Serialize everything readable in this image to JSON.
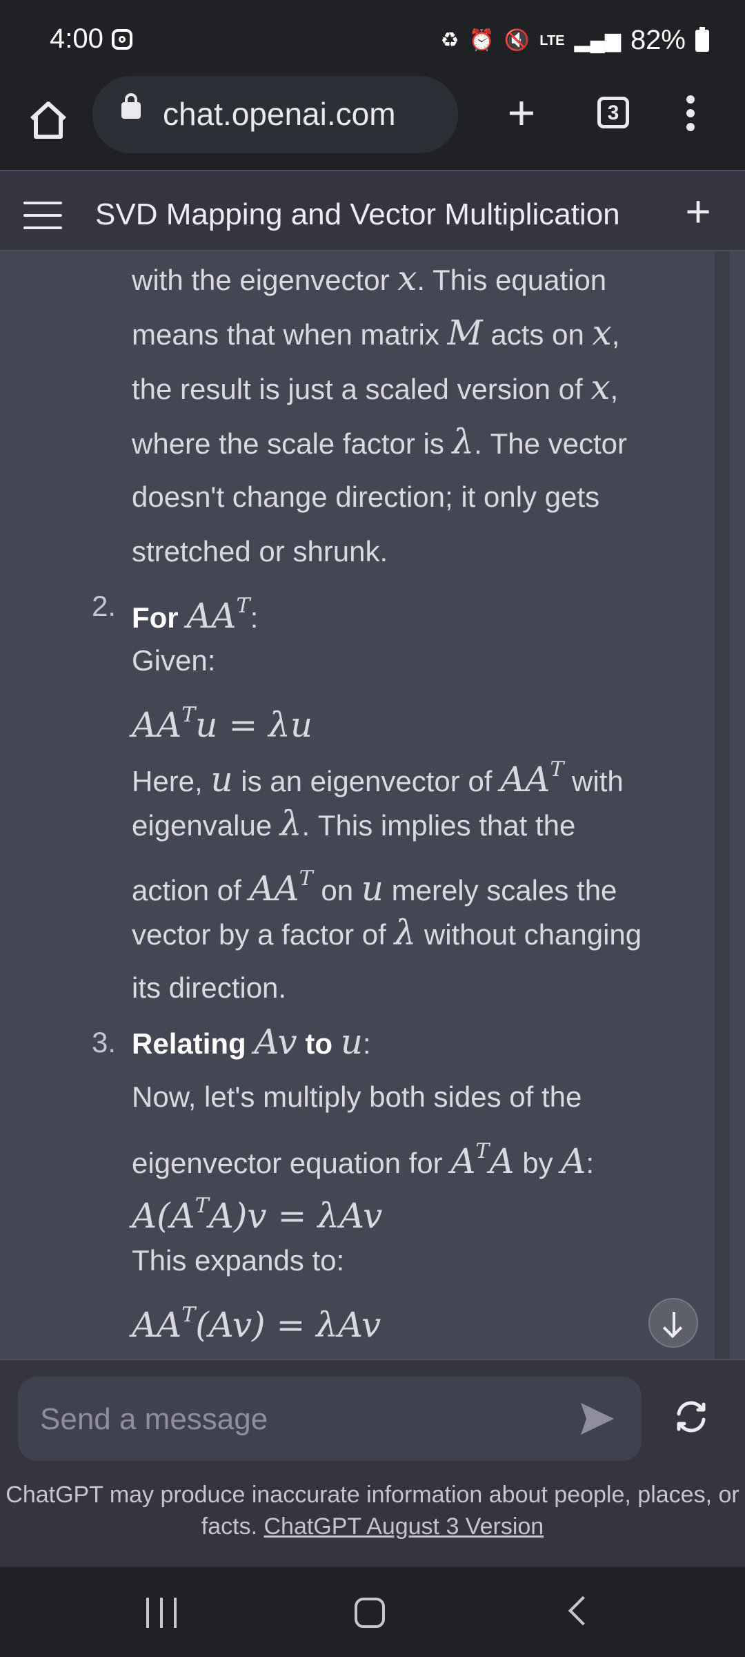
{
  "status_bar": {
    "time": "4:00",
    "network": "LTE",
    "battery": "82%"
  },
  "browser": {
    "url": "chat.openai.com",
    "tab_count": "3"
  },
  "chat": {
    "title": "SVD Mapping and Vector Multiplication"
  },
  "message": {
    "para1": {
      "l1a": "with the eigenvector ",
      "l1m": "x",
      "l1b": ". This equation",
      "l2a": "means that when matrix ",
      "l2m": "M",
      "l2b": " acts on ",
      "l2m2": "x",
      "l2c": ",",
      "l3a": "the result is just a scaled version of ",
      "l3m": "x",
      "l3b": ",",
      "l4a": "where the scale factor is ",
      "l4m": "λ",
      "l4b": ". The vector",
      "l5": "doesn't change direction; it only gets",
      "l6": "stretched or shrunk."
    },
    "item2": {
      "number": "2.",
      "title_pre": "For ",
      "title_math": "AA",
      "title_sup": "T",
      "title_post": ":",
      "given": "Given:",
      "eq_a": "AA",
      "eq_sup": "T",
      "eq_b": "u",
      "eq_op": " = ",
      "eq_c": "λu",
      "l1a": "Here, ",
      "l1m": "u",
      "l1b": " is an eigenvector of ",
      "l1m2": "AA",
      "l1sup": "T",
      "l1c": " with",
      "l2a": "eigenvalue ",
      "l2m": "λ",
      "l2b": ". This implies that the",
      "l3a": "action of ",
      "l3m": "AA",
      "l3sup": "T",
      "l3b": " on ",
      "l3m2": "u",
      "l3c": " merely scales the",
      "l4a": "vector by a factor of ",
      "l4m": "λ",
      "l4b": " without changing",
      "l5": "its direction."
    },
    "item3": {
      "number": "3.",
      "title_pre": "Relating ",
      "title_math": "Av",
      "title_mid": " to ",
      "title_math2": "u",
      "title_post": ":",
      "l1": "Now, let's multiply both sides of the",
      "l2a": "eigenvector equation for ",
      "l2m": "A",
      "l2sup": "T",
      "l2m2": "A",
      "l2b": " by ",
      "l2m3": "A",
      "l2c": ":",
      "eq1a": "A(A",
      "eq1sup": "T",
      "eq1b": "A)v",
      "eq1op": " = ",
      "eq1c": "λAv",
      "expands": "This expands to:",
      "eq2a": "AA",
      "eq2sup": "T",
      "eq2b": "(Av)",
      "eq2op": " = ",
      "eq2c": "λAv"
    }
  },
  "composer": {
    "placeholder": "Send a message"
  },
  "disclaimer": {
    "text": "ChatGPT may produce inaccurate information about people, places, or facts. ",
    "link": "ChatGPT August 3 Version"
  }
}
